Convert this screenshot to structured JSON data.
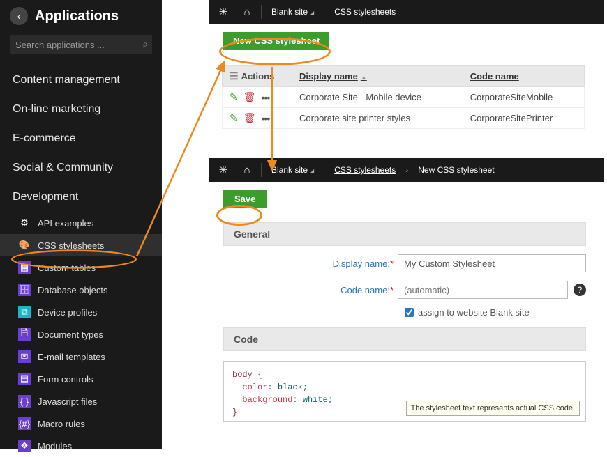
{
  "sidebar": {
    "title": "Applications",
    "search_placeholder": "Search applications ...",
    "categories": [
      "Content management",
      "On-line marketing",
      "E-commerce",
      "Social & Community",
      "Development"
    ],
    "dev_items": [
      {
        "icon": "gear",
        "label": "API examples",
        "selected": false
      },
      {
        "icon": "palette",
        "label": "CSS stylesheets",
        "selected": true
      },
      {
        "icon": "table",
        "label": "Custom tables",
        "selected": false
      },
      {
        "icon": "db",
        "label": "Database objects",
        "selected": false
      },
      {
        "icon": "devices",
        "label": "Device profiles",
        "selected": false
      },
      {
        "icon": "doc",
        "label": "Document types",
        "selected": false
      },
      {
        "icon": "mail",
        "label": "E-mail templates",
        "selected": false
      },
      {
        "icon": "form",
        "label": "Form controls",
        "selected": false
      },
      {
        "icon": "js",
        "label": "Javascript files",
        "selected": false
      },
      {
        "icon": "macro",
        "label": "Macro rules",
        "selected": false
      },
      {
        "icon": "module",
        "label": "Modules",
        "selected": false
      }
    ]
  },
  "icons": {
    "gear": "⚙",
    "palette": "🎨",
    "table": "▦",
    "db": "🗄",
    "devices": "⧉",
    "doc": "🗎",
    "mail": "✉",
    "form": "▤",
    "js": "{ }",
    "macro": "{#}",
    "module": "❖",
    "home": "⌂",
    "logo": "✳",
    "hamburger": "☰",
    "sort": "▲"
  },
  "panel1": {
    "breadcrumb_site": "Blank site",
    "breadcrumb_page": "CSS stylesheets",
    "new_button": "New CSS stylesheet",
    "columns": {
      "actions": "Actions",
      "display": "Display name",
      "code": "Code name"
    },
    "rows": [
      {
        "display": "Corporate Site - Mobile device",
        "code": "CorporateSiteMobile"
      },
      {
        "display": "Corporate site printer styles",
        "code": "CorporateSitePrinter"
      }
    ]
  },
  "panel2": {
    "breadcrumb_site": "Blank site",
    "breadcrumb_link": "CSS stylesheets",
    "breadcrumb_current": "New CSS stylesheet",
    "save": "Save",
    "section_general": "General",
    "section_code": "Code",
    "display_label": "Display name:",
    "display_value": "My Custom Stylesheet",
    "code_label": "Code name:",
    "code_placeholder": "(automatic)",
    "assign_label": "assign to website Blank site",
    "code_body": "body {",
    "code_l1a": "color",
    "code_l1b": ": black;",
    "code_l2a": "background",
    "code_l2b": ": white;",
    "code_end": "}",
    "tooltip": "The stylesheet text represents actual CSS code."
  }
}
